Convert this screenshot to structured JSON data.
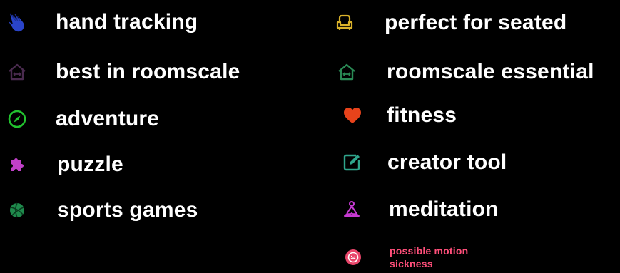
{
  "legend": {
    "left": [
      {
        "label": "hand tracking",
        "icon": "hand-icon",
        "color": "#2a44c9"
      },
      {
        "label": "best in roomscale",
        "icon": "roomscale-home-icon",
        "color": "#4a2b4f"
      },
      {
        "label": "adventure",
        "icon": "compass-icon",
        "color": "#22c32f"
      },
      {
        "label": "puzzle",
        "icon": "puzzle-piece-icon",
        "color": "#c040c8"
      },
      {
        "label": "sports games",
        "icon": "volleyball-icon",
        "color": "#1f8a4c"
      }
    ],
    "right": [
      {
        "label": "perfect for seated",
        "icon": "armchair-icon",
        "color": "#d9b12a"
      },
      {
        "label": "roomscale essential",
        "icon": "roomscale-home-icon",
        "color": "#2a8a55"
      },
      {
        "label": "fitness",
        "icon": "heart-icon",
        "color": "#e8431b"
      },
      {
        "label": "creator tool",
        "icon": "edit-square-icon",
        "color": "#2fa58c"
      },
      {
        "label": "meditation",
        "icon": "meditation-icon",
        "color": "#c63ad1"
      },
      {
        "label": "possible motion sickness",
        "icon": "queasy-face-icon",
        "color": "#e8456a",
        "label_color": "#ff4f7a"
      }
    ]
  }
}
